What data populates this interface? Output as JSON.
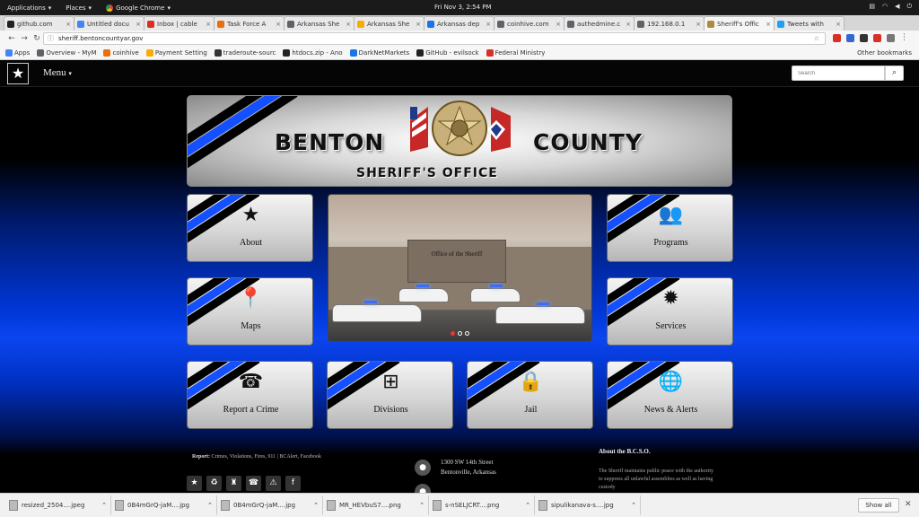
{
  "gnome": {
    "applications": "Applications",
    "places": "Places",
    "app": "Google Chrome",
    "clock": "Fri Nov 3,  2:54 PM"
  },
  "tabs": [
    {
      "title": "github.com",
      "color": "#222222"
    },
    {
      "title": "Untitled docu",
      "color": "#4285f4"
    },
    {
      "title": "Inbox | cable",
      "color": "#d93025"
    },
    {
      "title": "Task Force A",
      "color": "#e8710a"
    },
    {
      "title": "Arkansas She",
      "color": "#5f6368"
    },
    {
      "title": "Arkansas She",
      "color": "#f9ab00"
    },
    {
      "title": "Arkansas dep",
      "color": "#1a73e8"
    },
    {
      "title": "coinhive.com",
      "color": "#5f6368"
    },
    {
      "title": "authedmine.c",
      "color": "#5f6368"
    },
    {
      "title": "192.168.0.1",
      "color": "#5f6368"
    },
    {
      "title": "Sheriff's Offic",
      "color": "#b08a3a",
      "active": true
    },
    {
      "title": "Tweets with",
      "color": "#1da1f2"
    }
  ],
  "address": {
    "url": "sheriff.bentoncountyar.gov"
  },
  "bookmarks": {
    "items": [
      "Apps",
      "Overview - MyM",
      "coinhive",
      "Payment Setting",
      "traderoute-sourc",
      "htdocs.zip - Ano",
      "DarkNetMarkets",
      "GitHub - evilsock",
      "Federal Ministry"
    ],
    "other": "Other bookmarks"
  },
  "site": {
    "menu_label": "Menu",
    "search_placeholder": "Search",
    "banner": {
      "word1": "BENTON",
      "word2": "COUNTY",
      "subtitle": "SHERIFF'S OFFICE",
      "badge_text": "BENTON COUNTY · DEPUTY · SHERIFF'S OFFICE"
    },
    "slide_sign": "Office of the Sheriff",
    "tiles": [
      {
        "label": "About",
        "icon": "star-icon",
        "glyph": "★"
      },
      {
        "label": "Programs",
        "icon": "users-icon",
        "glyph": "👥"
      },
      {
        "label": "Maps",
        "icon": "map-pin-icon",
        "glyph": "📍"
      },
      {
        "label": "Services",
        "icon": "gear-icon",
        "glyph": "✹"
      },
      {
        "label": "Report a Crime",
        "icon": "phone-icon",
        "glyph": "☎"
      },
      {
        "label": "Divisions",
        "icon": "org-chart-icon",
        "glyph": "⊞"
      },
      {
        "label": "Jail",
        "icon": "lock-icon",
        "glyph": "🔒"
      },
      {
        "label": "News & Alerts",
        "icon": "globe-icon",
        "glyph": "🌐"
      }
    ],
    "footer": {
      "report_label": "Report:",
      "report_text": "Crimes, Violations, Fires, 911 | BCAlert, Facebook",
      "address_line1": "1300 SW 14th Street",
      "address_line2": "Bentonville, Arkansas",
      "about_heading": "About the B.C.S.O.",
      "about_text": "The Sheriff maintains public peace with the authority to suppress all unlawful assemblies as well as having custody"
    }
  },
  "downloads": {
    "items": [
      "resized_2504....jpeg",
      "0B4mGrQ-jaM....jpg",
      "0B4mGrQ-jaM....jpg",
      "MR_HEVbuS7....png",
      "s-nSELJCRT....png",
      "sipulikanava-s....jpg"
    ],
    "show_all": "Show all"
  }
}
